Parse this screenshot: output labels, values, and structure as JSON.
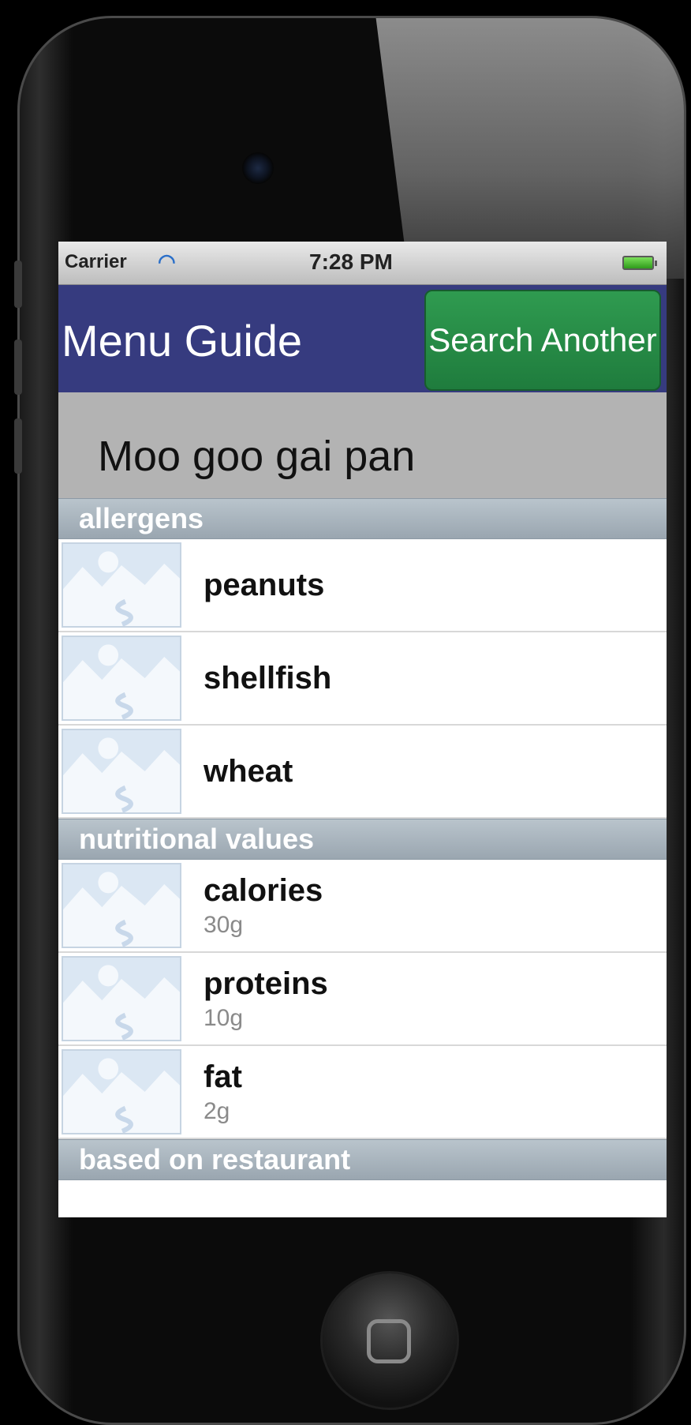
{
  "status_bar": {
    "carrier": "Carrier",
    "time": "7:28 PM"
  },
  "nav": {
    "title": "Menu Guide",
    "action_label": "Search Another"
  },
  "dish": {
    "name": "Moo goo gai pan"
  },
  "allergens": {
    "header": "allergens",
    "items": [
      {
        "label": "peanuts"
      },
      {
        "label": "shellfish"
      },
      {
        "label": "wheat"
      }
    ]
  },
  "nutrition": {
    "header": "nutritional values",
    "items": [
      {
        "label": "calories",
        "value": "30g"
      },
      {
        "label": "proteins",
        "value": "10g"
      },
      {
        "label": "fat",
        "value": "2g"
      }
    ]
  },
  "restaurant": {
    "header": "based on restaurant"
  },
  "colors": {
    "nav_bg": "#363b7f",
    "button_green": "#2f9b50",
    "section_header": "#a9b4be"
  }
}
